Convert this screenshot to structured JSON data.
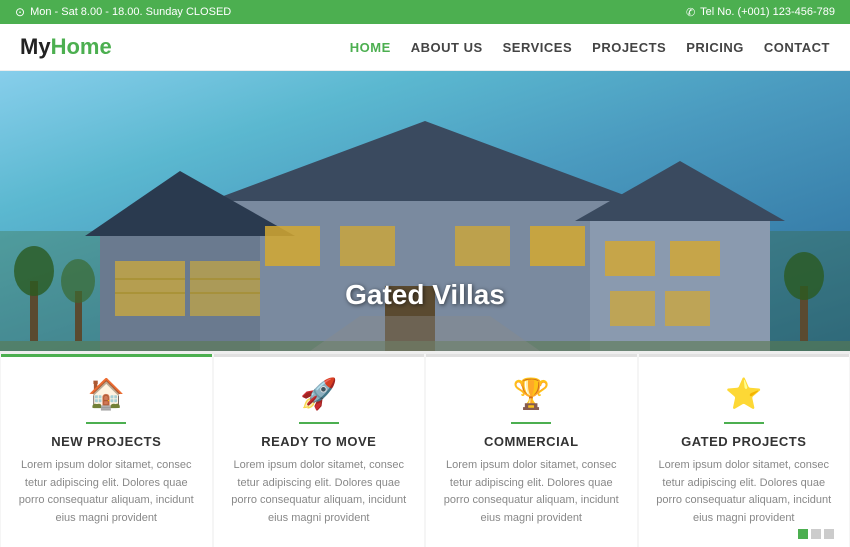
{
  "topbar": {
    "hours": "Mon - Sat 8.00 - 18.00. Sunday CLOSED",
    "phone": "Tel No. (+001) 123-456-789",
    "clock_icon": "○",
    "phone_icon": "✆"
  },
  "header": {
    "logo_my": "My",
    "logo_home": "Home",
    "nav": {
      "home": "HOME",
      "about": "ABOUT US",
      "services": "SERVICES",
      "projects": "PROJECTS",
      "pricing": "PRICING",
      "contact": "CONTACT"
    }
  },
  "hero": {
    "title": "Gated Villas"
  },
  "cards": [
    {
      "icon": "🏠",
      "title": "NEW PROJECTS",
      "text": "Lorem ipsum dolor sitamet, consec tetur adipiscing elit. Dolores quae porro consequatur aliquam, incidunt eius magni provident"
    },
    {
      "icon": "🚀",
      "title": "READY TO MOVE",
      "text": "Lorem ipsum dolor sitamet, consec tetur adipiscing elit. Dolores quae porro consequatur aliquam, incidunt eius magni provident"
    },
    {
      "icon": "🏆",
      "title": "COMMERCIAL",
      "text": "Lorem ipsum dolor sitamet, consec tetur adipiscing elit. Dolores quae porro consequatur aliquam, incidunt eius magni provident"
    },
    {
      "icon": "⭐",
      "title": "GATED PROJECTS",
      "text": "Lorem ipsum dolor sitamet, consec tetur adipiscing elit. Dolores quae porro consequatur aliquam, incidunt eius magni provident"
    }
  ],
  "colors": {
    "green": "#4caf50",
    "dark": "#333333",
    "gray": "#888888"
  }
}
